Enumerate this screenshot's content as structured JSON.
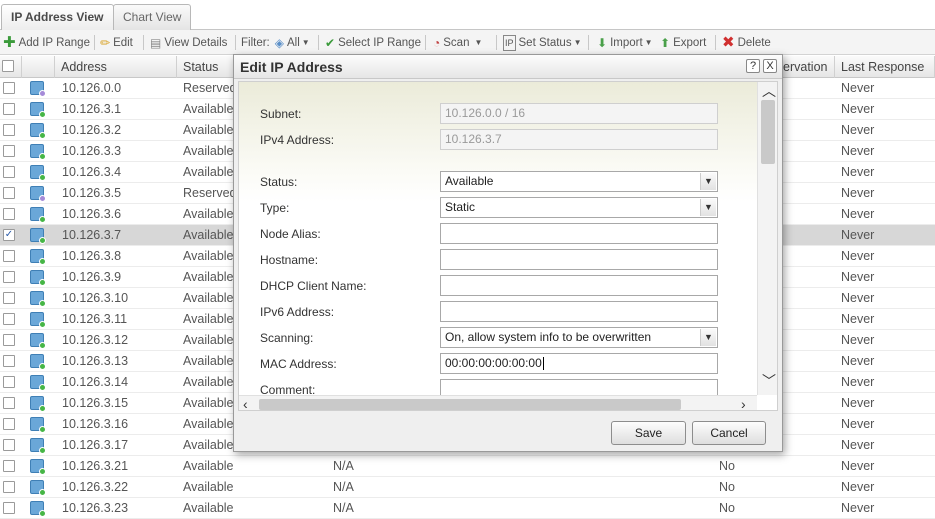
{
  "tabs": [
    {
      "label": "IP Address View",
      "active": true
    },
    {
      "label": "Chart View",
      "active": false
    }
  ],
  "toolbar": {
    "add_ip_range": "Add IP Range",
    "edit": "Edit",
    "view_details": "View Details",
    "filter_label": "Filter:",
    "filter_value": "All",
    "select_ip_range": "Select IP Range",
    "scan": "Scan",
    "set_status": "Set Status",
    "import": "Import",
    "export": "Export",
    "delete": "Delete"
  },
  "grid": {
    "headers": {
      "address": "Address",
      "status": "Status",
      "reservation": "ervation",
      "last_response": "Last Response"
    },
    "rows": [
      {
        "address": "10.126.0.0",
        "status": "Reserved",
        "col3": "",
        "col4": "",
        "last": "Never",
        "icon": "reserved",
        "selected": false
      },
      {
        "address": "10.126.3.1",
        "status": "Available",
        "col3": "",
        "col4": "",
        "last": "Never",
        "icon": "available",
        "selected": false
      },
      {
        "address": "10.126.3.2",
        "status": "Available",
        "col3": "",
        "col4": "",
        "last": "Never",
        "icon": "available",
        "selected": false
      },
      {
        "address": "10.126.3.3",
        "status": "Available",
        "col3": "",
        "col4": "",
        "last": "Never",
        "icon": "available",
        "selected": false
      },
      {
        "address": "10.126.3.4",
        "status": "Available",
        "col3": "",
        "col4": "",
        "last": "Never",
        "icon": "available",
        "selected": false
      },
      {
        "address": "10.126.3.5",
        "status": "Reserved",
        "col3": "",
        "col4": "",
        "last": "Never",
        "icon": "reserved",
        "selected": false
      },
      {
        "address": "10.126.3.6",
        "status": "Available",
        "col3": "",
        "col4": "",
        "last": "Never",
        "icon": "available",
        "selected": false
      },
      {
        "address": "10.126.3.7",
        "status": "Available",
        "col3": "",
        "col4": "",
        "last": "Never",
        "icon": "available",
        "selected": true
      },
      {
        "address": "10.126.3.8",
        "status": "Available",
        "col3": "",
        "col4": "",
        "last": "Never",
        "icon": "available",
        "selected": false
      },
      {
        "address": "10.126.3.9",
        "status": "Available",
        "col3": "",
        "col4": "",
        "last": "Never",
        "icon": "available",
        "selected": false
      },
      {
        "address": "10.126.3.10",
        "status": "Available",
        "col3": "",
        "col4": "",
        "last": "Never",
        "icon": "available",
        "selected": false
      },
      {
        "address": "10.126.3.11",
        "status": "Available",
        "col3": "",
        "col4": "",
        "last": "Never",
        "icon": "available",
        "selected": false
      },
      {
        "address": "10.126.3.12",
        "status": "Available",
        "col3": "",
        "col4": "",
        "last": "Never",
        "icon": "available",
        "selected": false
      },
      {
        "address": "10.126.3.13",
        "status": "Available",
        "col3": "",
        "col4": "",
        "last": "Never",
        "icon": "available",
        "selected": false
      },
      {
        "address": "10.126.3.14",
        "status": "Available",
        "col3": "",
        "col4": "",
        "last": "Never",
        "icon": "available",
        "selected": false
      },
      {
        "address": "10.126.3.15",
        "status": "Available",
        "col3": "",
        "col4": "",
        "last": "Never",
        "icon": "available",
        "selected": false
      },
      {
        "address": "10.126.3.16",
        "status": "Available",
        "col3": "",
        "col4": "",
        "last": "Never",
        "icon": "available",
        "selected": false
      },
      {
        "address": "10.126.3.17",
        "status": "Available",
        "col3": "",
        "col4": "",
        "last": "Never",
        "icon": "available",
        "selected": false
      },
      {
        "address": "10.126.3.21",
        "status": "Available",
        "col3": "N/A",
        "col4": "No",
        "last": "Never",
        "icon": "available",
        "selected": false
      },
      {
        "address": "10.126.3.22",
        "status": "Available",
        "col3": "N/A",
        "col4": "No",
        "last": "Never",
        "icon": "available",
        "selected": false
      },
      {
        "address": "10.126.3.23",
        "status": "Available",
        "col3": "N/A",
        "col4": "No",
        "last": "Never",
        "icon": "available",
        "selected": false
      }
    ]
  },
  "dialog": {
    "title": "Edit IP Address",
    "help": "?",
    "close": "X",
    "fields": {
      "subnet": {
        "label": "Subnet:",
        "value": "10.126.0.0 / 16"
      },
      "ipv4": {
        "label": "IPv4 Address:",
        "value": "10.126.3.7"
      },
      "status": {
        "label": "Status:",
        "value": "Available"
      },
      "type": {
        "label": "Type:",
        "value": "Static"
      },
      "node_alias": {
        "label": "Node Alias:",
        "value": ""
      },
      "hostname": {
        "label": "Hostname:",
        "value": ""
      },
      "dhcp_client": {
        "label": "DHCP Client Name:",
        "value": ""
      },
      "ipv6": {
        "label": "IPv6 Address:",
        "value": ""
      },
      "scanning": {
        "label": "Scanning:",
        "value": "On, allow system info to be overwritten"
      },
      "mac": {
        "label": "MAC Address:",
        "value": "00:00:00:00:00:00"
      },
      "comment": {
        "label": "Comment:",
        "value": ""
      }
    },
    "save": "Save",
    "cancel": "Cancel"
  }
}
